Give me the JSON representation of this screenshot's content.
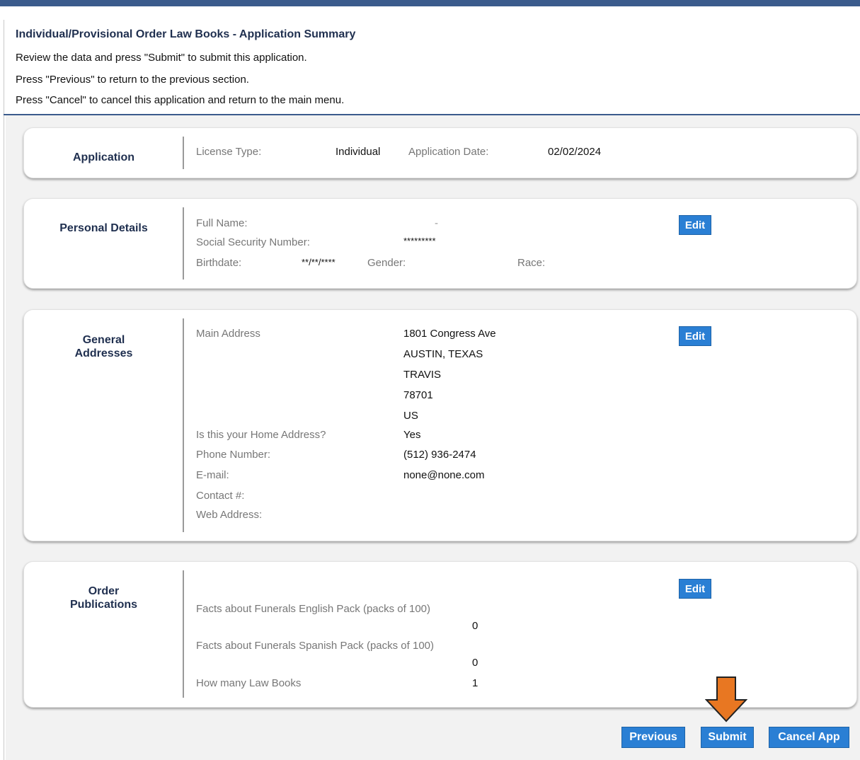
{
  "header": {
    "title": "Individual/Provisional Order Law Books - Application Summary",
    "line1": "Review the data and press \"Submit\" to submit this application.",
    "line2": "Press \"Previous\" to return to the previous section.",
    "line3": "Press \"Cancel\" to cancel this application and return to the main menu."
  },
  "application": {
    "title": "Application",
    "license_type_label": "License Type:",
    "license_type_value": "Individual",
    "date_label": "Application Date:",
    "date_value": "02/02/2024"
  },
  "personal": {
    "title": "Personal Details",
    "full_name_label": "Full Name:",
    "full_name_value": "-",
    "ssn_label": "Social Security Number:",
    "ssn_value": "*********",
    "birthdate_label": "Birthdate:",
    "birthdate_value": "**/**/****",
    "gender_label": "Gender:",
    "race_label": "Race:",
    "edit_label": "Edit"
  },
  "addresses": {
    "title_line1": "General",
    "title_line2": "Addresses",
    "main_address_label": "Main Address",
    "address_lines": [
      "1801 Congress Ave",
      "AUSTIN, TEXAS",
      "TRAVIS",
      "78701",
      "US"
    ],
    "home_label": "Is this your Home Address?",
    "home_value": "Yes",
    "phone_label": "Phone Number:",
    "phone_value": "(512) 936-2474",
    "email_label": "E-mail:",
    "email_value": "none@none.com",
    "contact_label": "Contact #:",
    "web_label": "Web Address:",
    "edit_label": "Edit"
  },
  "publications": {
    "title_line1": "Order",
    "title_line2": "Publications",
    "items": [
      {
        "label": "Facts about Funerals English Pack (packs of 100)",
        "value": "0"
      },
      {
        "label": "Facts about Funerals Spanish Pack (packs of 100)",
        "value": "0"
      },
      {
        "label": "How many Law Books",
        "value": "1"
      }
    ],
    "edit_label": "Edit"
  },
  "footer": {
    "previous_label": "Previous",
    "submit_label": "Submit",
    "cancel_label": "Cancel App"
  },
  "colors": {
    "button": "#2a7fd4",
    "accent_bar": "#3b5b8c",
    "arrow": "#e87722"
  },
  "icons": {
    "pointer_arrow": "down-arrow-icon"
  }
}
